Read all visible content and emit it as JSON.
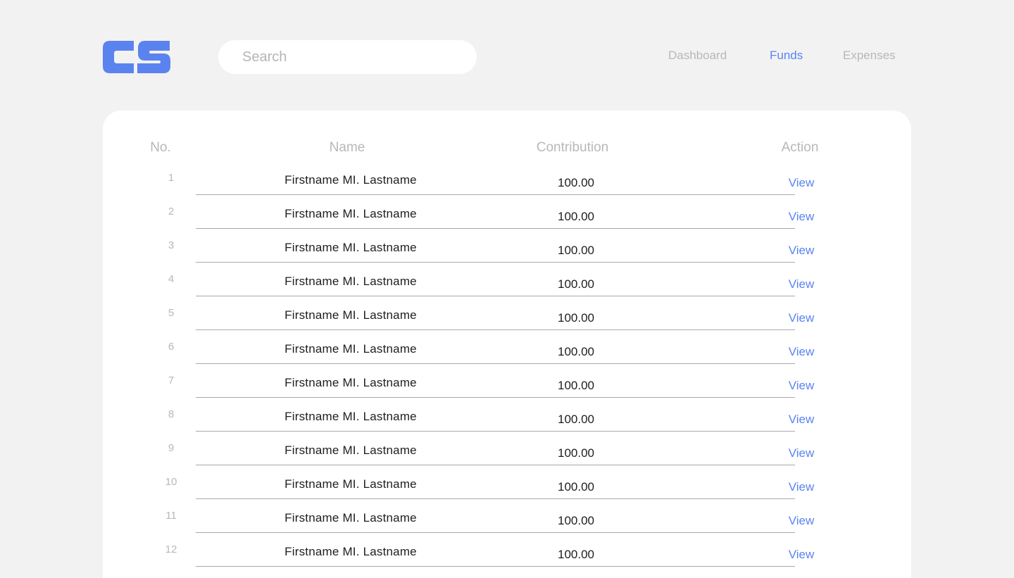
{
  "logo": {
    "text": "CS",
    "color": "#5b83f0"
  },
  "search": {
    "placeholder": "Search",
    "value": ""
  },
  "nav": {
    "items": [
      {
        "label": "Dashboard",
        "active": false
      },
      {
        "label": "Funds",
        "active": true
      },
      {
        "label": "Expenses",
        "active": false
      }
    ]
  },
  "table": {
    "headers": {
      "no": "No.",
      "name": "Name",
      "contribution": "Contribution",
      "action": "Action"
    },
    "rows": [
      {
        "no": "1",
        "name": "Firstname MI. Lastname",
        "contribution": "100.00",
        "action": "View"
      },
      {
        "no": "2",
        "name": "Firstname MI. Lastname",
        "contribution": "100.00",
        "action": "View"
      },
      {
        "no": "3",
        "name": "Firstname MI. Lastname",
        "contribution": "100.00",
        "action": "View"
      },
      {
        "no": "4",
        "name": "Firstname MI. Lastname",
        "contribution": "100.00",
        "action": "View"
      },
      {
        "no": "5",
        "name": "Firstname MI. Lastname",
        "contribution": "100.00",
        "action": "View"
      },
      {
        "no": "6",
        "name": "Firstname MI. Lastname",
        "contribution": "100.00",
        "action": "View"
      },
      {
        "no": "7",
        "name": "Firstname MI. Lastname",
        "contribution": "100.00",
        "action": "View"
      },
      {
        "no": "8",
        "name": "Firstname MI. Lastname",
        "contribution": "100.00",
        "action": "View"
      },
      {
        "no": "9",
        "name": "Firstname MI. Lastname",
        "contribution": "100.00",
        "action": "View"
      },
      {
        "no": "10",
        "name": "Firstname MI. Lastname",
        "contribution": "100.00",
        "action": "View"
      },
      {
        "no": "11",
        "name": "Firstname MI. Lastname",
        "contribution": "100.00",
        "action": "View"
      },
      {
        "no": "12",
        "name": "Firstname MI. Lastname",
        "contribution": "100.00",
        "action": "View"
      }
    ]
  },
  "colors": {
    "accent": "#5b83f0",
    "background": "#f2f2f2",
    "card": "#ffffff",
    "muted": "#b8b8b8"
  }
}
